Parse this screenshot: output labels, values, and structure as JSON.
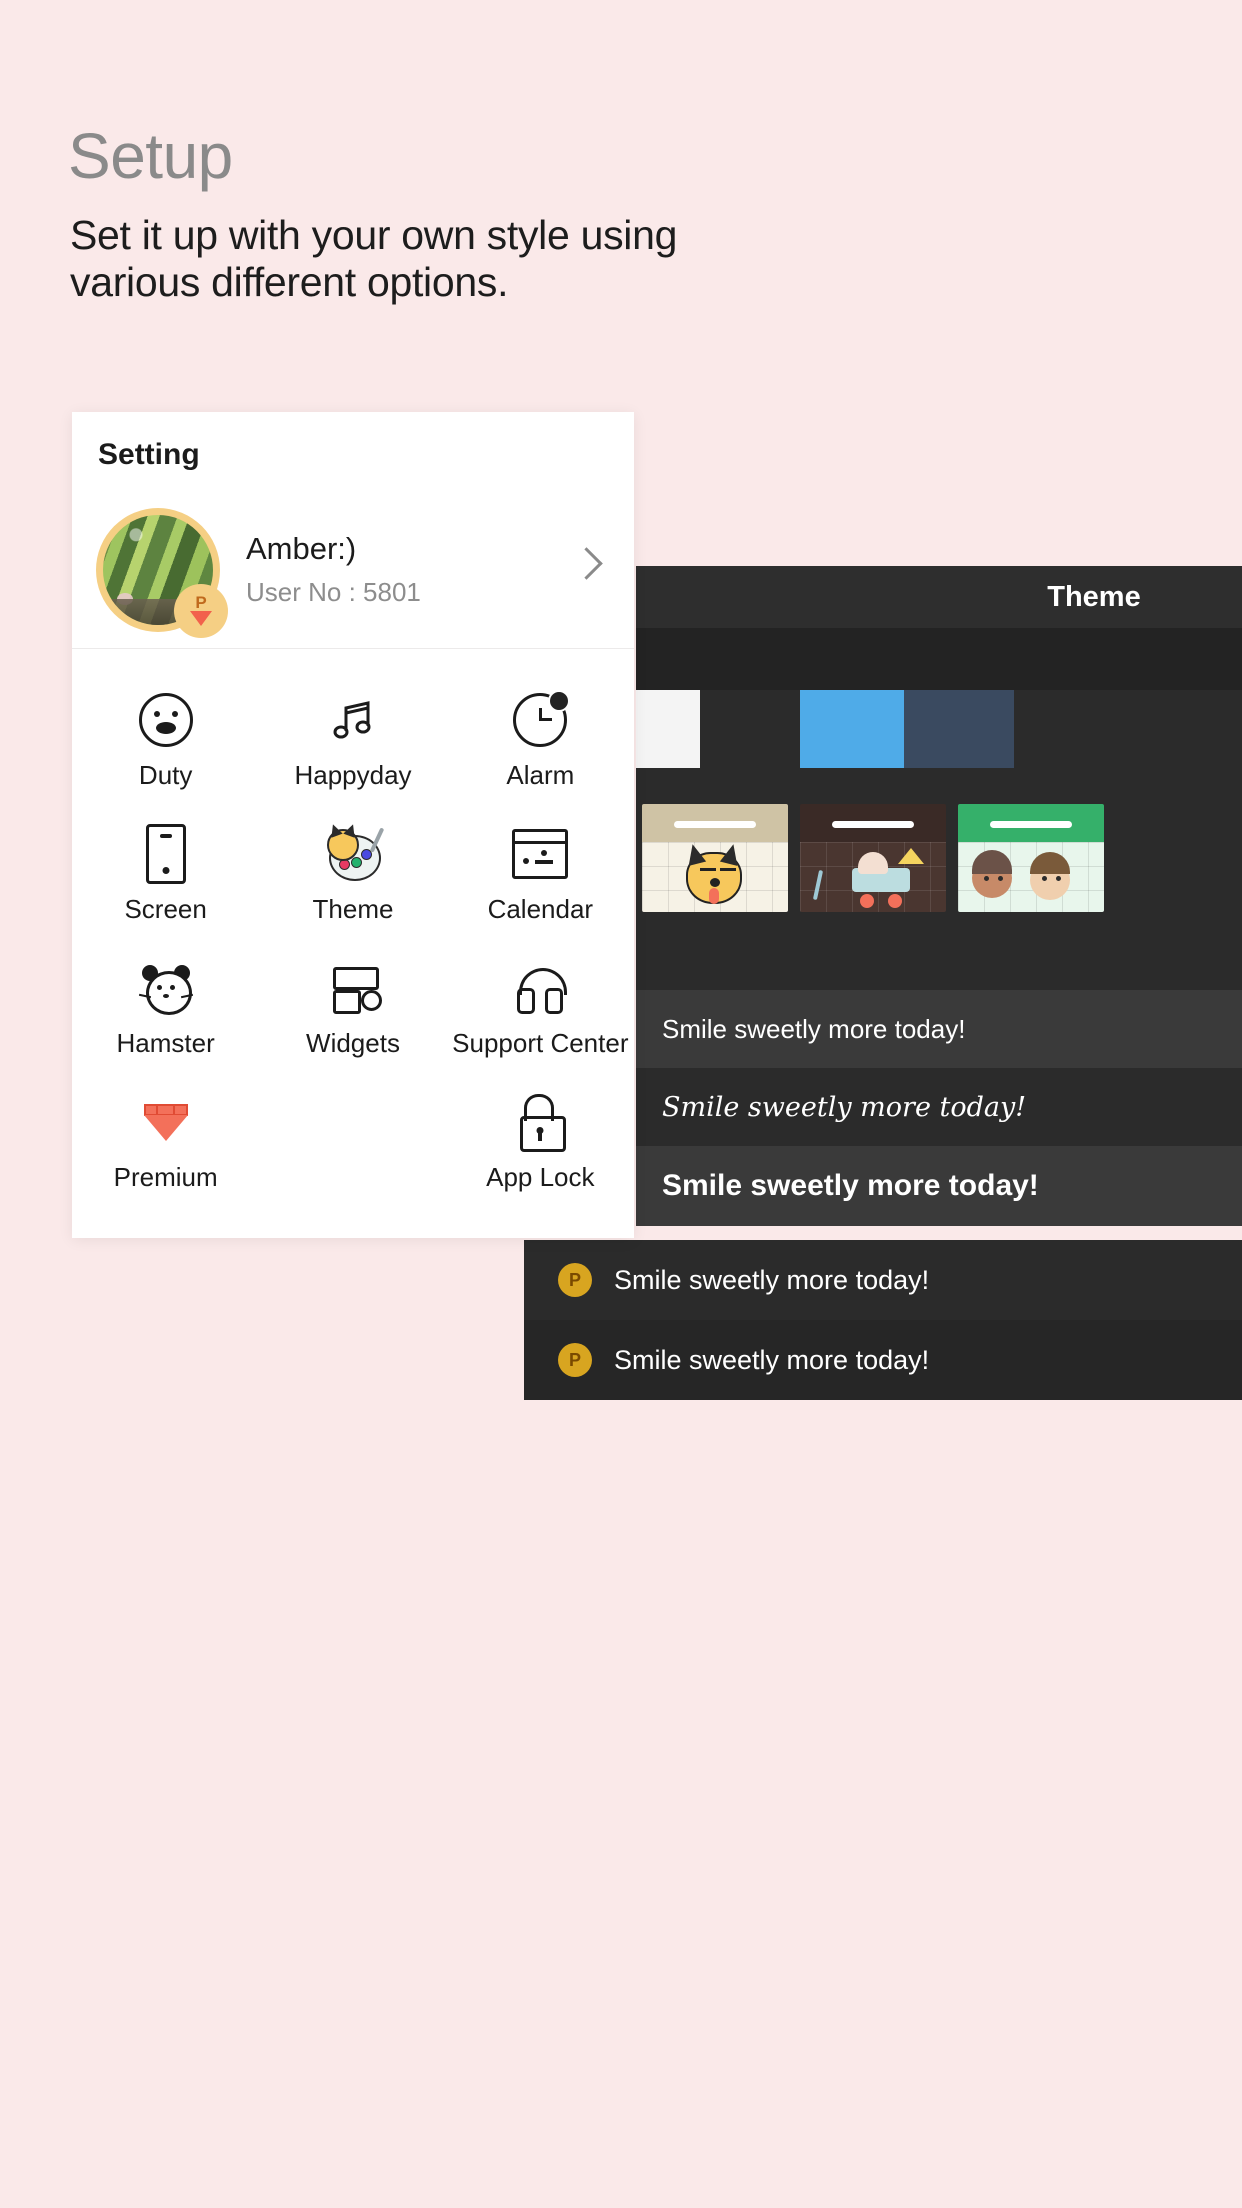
{
  "hero": {
    "title": "Setup",
    "subtitle": "Set it up with your own style using various different options."
  },
  "setting_card": {
    "title": "Setting",
    "profile": {
      "name": "Amber:)",
      "user_no_label": "User No : 5801",
      "badge_letter": "P",
      "avatar_name": "cactus-photo-avatar",
      "chevron": "chevron-right-icon"
    },
    "menu": [
      {
        "label": "Duty",
        "icon": "face-icon"
      },
      {
        "label": "Happyday",
        "icon": "music-note-icon"
      },
      {
        "label": "Alarm",
        "icon": "clock-alarm-icon"
      },
      {
        "label": "Screen",
        "icon": "phone-screen-icon"
      },
      {
        "label": "Theme",
        "icon": "palette-icon"
      },
      {
        "label": "Calendar",
        "icon": "calendar-icon"
      },
      {
        "label": "Hamster",
        "icon": "hamster-face-icon"
      },
      {
        "label": "Widgets",
        "icon": "widgets-icon"
      },
      {
        "label": "Support Center",
        "icon": "headphones-icon"
      },
      {
        "label": "Premium",
        "icon": "diamond-icon"
      },
      {
        "label": "",
        "icon": ""
      },
      {
        "label": "App Lock",
        "icon": "unlocked-padlock-icon"
      }
    ]
  },
  "theme_panel": {
    "header_title": "Theme",
    "color_swatches": [
      "#f4f4f4",
      "#2b2b2b",
      "#4fabe8",
      "#3a4a60"
    ],
    "thumbnails": [
      {
        "name": "dog-theme-thumb",
        "band": "#cfc3a5",
        "body": "#f6f2e6"
      },
      {
        "name": "wagon-theme-thumb",
        "band": "#3a2a26",
        "body": "#4a3630"
      },
      {
        "name": "friends-theme-thumb",
        "band": "#35b06a",
        "body": "#e8f6ec"
      }
    ],
    "messages": [
      {
        "text": "Smile sweetly more today!",
        "style": "plain"
      },
      {
        "text": "Smile sweetly more today!",
        "style": "script"
      },
      {
        "text": "Smile sweetly more today!",
        "style": "bold"
      }
    ]
  },
  "float_list": {
    "rows": [
      {
        "badge": "P",
        "text": "Smile sweetly more today!"
      },
      {
        "badge": "P",
        "text": "Smile sweetly more today!"
      }
    ]
  },
  "colors": {
    "background": "#fae9e9",
    "card": "#ffffff",
    "panel_dark": "#2b2b2b",
    "accent_yellow": "#f5cf84",
    "accent_red": "#f3705a"
  }
}
